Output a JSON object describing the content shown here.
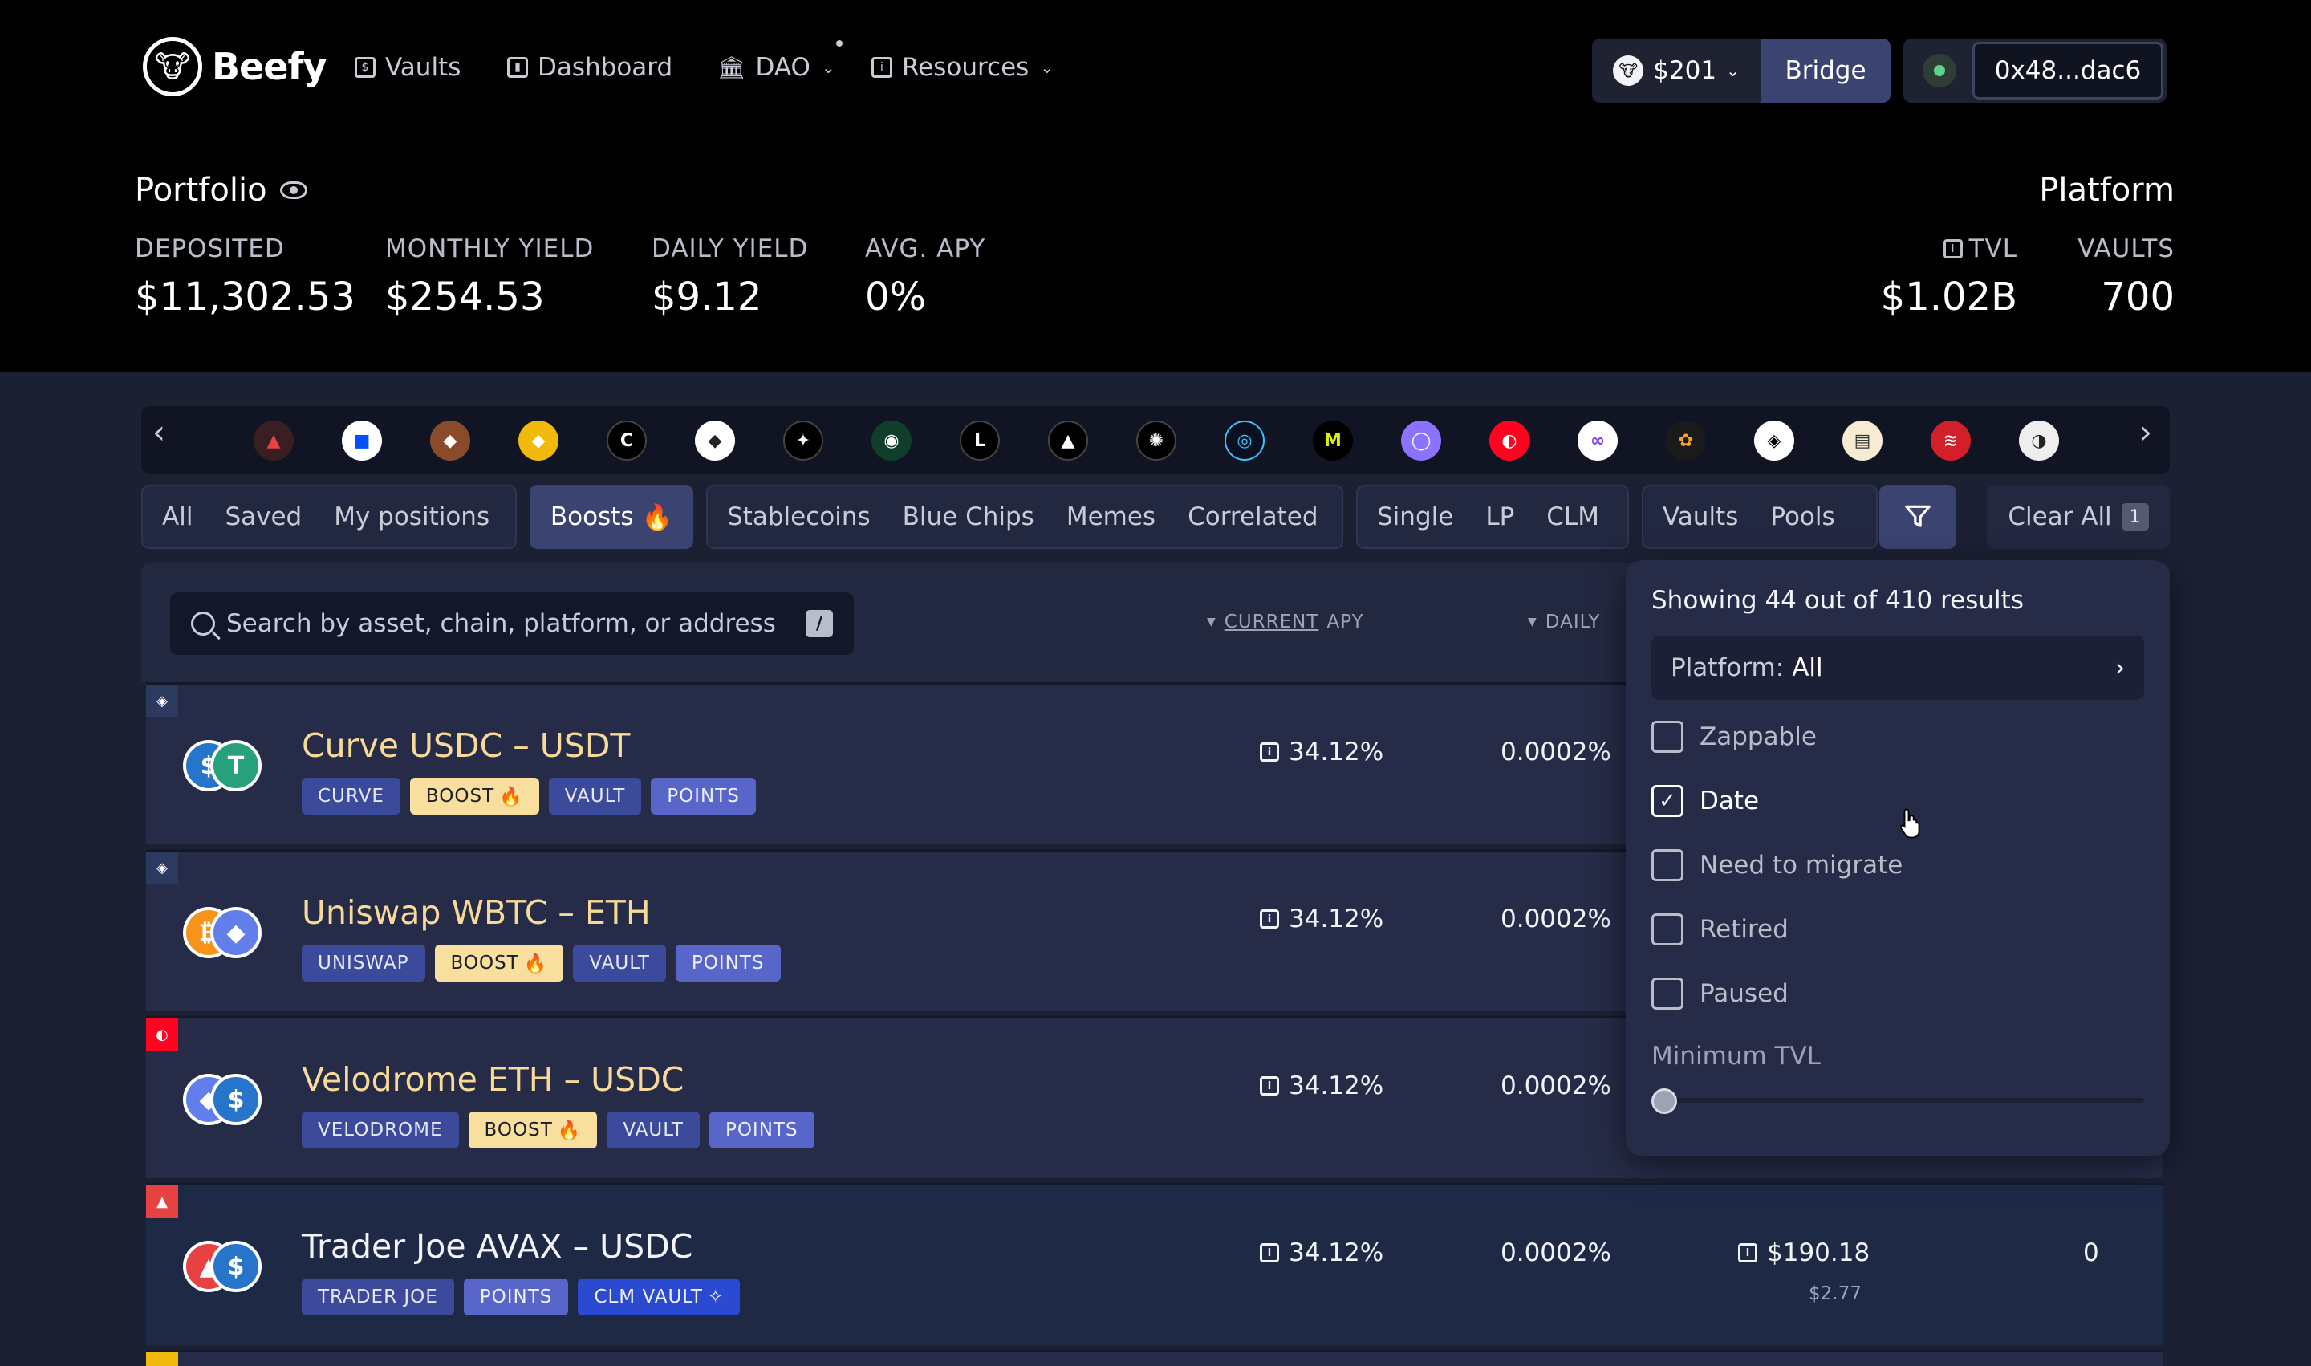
{
  "brand": {
    "name": "Beefy"
  },
  "nav": {
    "vaults": "Vaults",
    "dashboard": "Dashboard",
    "dao": "DAO",
    "resources": "Resources"
  },
  "header": {
    "price": "$201",
    "bridge": "Bridge",
    "wallet": "0x48...dac6"
  },
  "portfolio": {
    "title": "Portfolio",
    "stats": [
      {
        "label": "DEPOSITED",
        "value": "$11,302.53"
      },
      {
        "label": "MONTHLY YIELD",
        "value": "$254.53"
      },
      {
        "label": "DAILY YIELD",
        "value": "$9.12"
      },
      {
        "label": "AVG. APY",
        "value": "0%"
      }
    ]
  },
  "platform": {
    "title": "Platform",
    "stats": [
      {
        "label": "TVL",
        "value": "$1.02B"
      },
      {
        "label": "VAULTS",
        "value": "700"
      }
    ]
  },
  "filters": {
    "group1": [
      "All",
      "Saved",
      "My positions"
    ],
    "boosts": "Boosts",
    "group2": [
      "Stablecoins",
      "Blue Chips",
      "Memes",
      "Correlated"
    ],
    "group3": [
      "Single",
      "LP",
      "CLM"
    ],
    "group4": [
      "Vaults",
      "Pools"
    ],
    "clear": "Clear All",
    "clear_count": "1"
  },
  "search": {
    "placeholder": "Search by asset, chain, platform, or address",
    "shortcut": "/"
  },
  "columns": {
    "apy_a": "CURRENT",
    "apy_b": "APY",
    "daily": "DAILY"
  },
  "vaults": [
    {
      "name": "Curve USDC – USDT",
      "tags": [
        "CURVE",
        "BOOST",
        "VAULT",
        "POINTS"
      ],
      "apy": "34.12%",
      "daily": "0.0002%"
    },
    {
      "name": "Uniswap WBTC – ETH",
      "tags": [
        "UNISWAP",
        "BOOST",
        "VAULT",
        "POINTS"
      ],
      "apy": "34.12%",
      "daily": "0.0002%"
    },
    {
      "name": "Velodrome ETH – USDC",
      "tags": [
        "VELODROME",
        "BOOST",
        "VAULT",
        "POINTS"
      ],
      "apy": "34.12%",
      "daily": "0.0002%"
    },
    {
      "name": "Trader Joe AVAX – USDC",
      "tags": [
        "TRADER JOE",
        "POINTS",
        "CLM VAULT"
      ],
      "apy": "34.12%",
      "daily": "0.0002%",
      "tvl": "$190.18",
      "tvl_sub": "$2.77",
      "extra": "0"
    }
  ],
  "dropdown": {
    "title": "Showing 44 out of 410 results",
    "platform_label": "Platform:",
    "platform_value": "All",
    "checks": [
      {
        "label": "Zappable",
        "checked": false
      },
      {
        "label": "Date",
        "checked": true
      },
      {
        "label": "Need to migrate",
        "checked": false
      },
      {
        "label": "Retired",
        "checked": false
      },
      {
        "label": "Paused",
        "checked": false
      }
    ],
    "min_tvl": "Minimum TVL",
    "min_tvl_value": 0
  },
  "colors": {
    "accent": "#3b4370",
    "boost_tag": "#f8df9e",
    "vault_name": "#f7d99a",
    "background": "#1c2033"
  }
}
